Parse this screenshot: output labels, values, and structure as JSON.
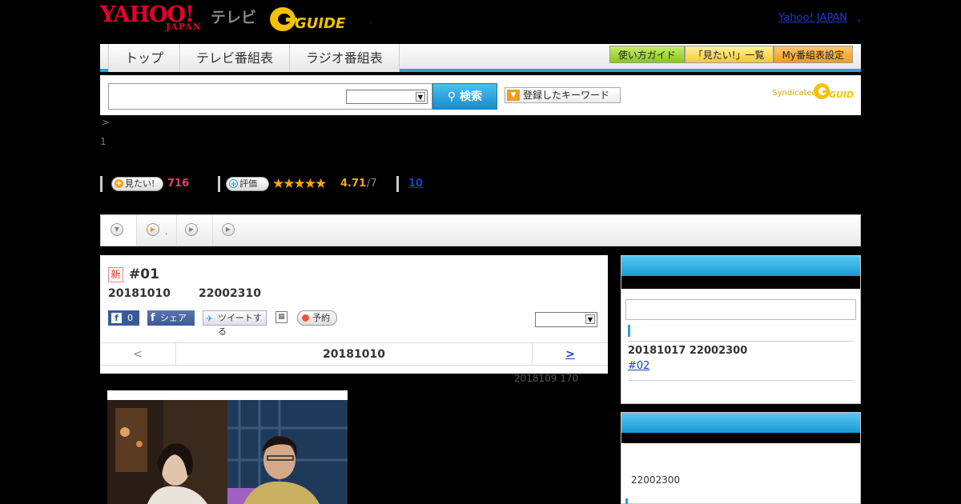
{
  "header": {
    "logo_yahoo": "YAHOO!",
    "logo_japan": "JAPAN",
    "logo_tv": "テレビ",
    "logo_gguide": "GUIDE",
    "dot": ".",
    "yahoo_japan_link": "Yahoo! JAPAN",
    "comma": ","
  },
  "nav": {
    "tabs": [
      {
        "label": "トップ"
      },
      {
        "label": "テレビ番組表"
      },
      {
        "label": "ラジオ番組表"
      }
    ],
    "buttons": [
      {
        "label": "使い方ガイド"
      },
      {
        "label": "「見たい!」一覧"
      },
      {
        "label": "My番組表設定"
      }
    ],
    "colors": {
      "accent": "#2aa4d8"
    }
  },
  "search": {
    "placeholder": "",
    "button_label": "検索",
    "keyword_button": "登録したキーワード",
    "syndicated": "Syndicated"
  },
  "breadcrumb": {
    "gt": ">",
    "page": "1"
  },
  "stats": {
    "mitai_label": "見たい!",
    "mitai_count": "716",
    "hyoka_label": "評価",
    "stars": "★★★★★",
    "rating": "4.71",
    "rating_sub": "/7",
    "review_count": "10"
  },
  "tabrow": {
    "tab2_dot": "."
  },
  "program": {
    "new_badge": "新",
    "title": "#01",
    "date": "20181010",
    "time": "22002310",
    "fb_like_count": "0",
    "fb_share": "シェア",
    "tweet": "ツイートする",
    "reserve": "予約",
    "nav_prev": "<",
    "nav_current": "20181010",
    "nav_next": ">",
    "meta": "2018109  170"
  },
  "sidebar": {
    "next_date": "20181017  22002300",
    "next_ep": "#02",
    "time2": "22002300"
  }
}
